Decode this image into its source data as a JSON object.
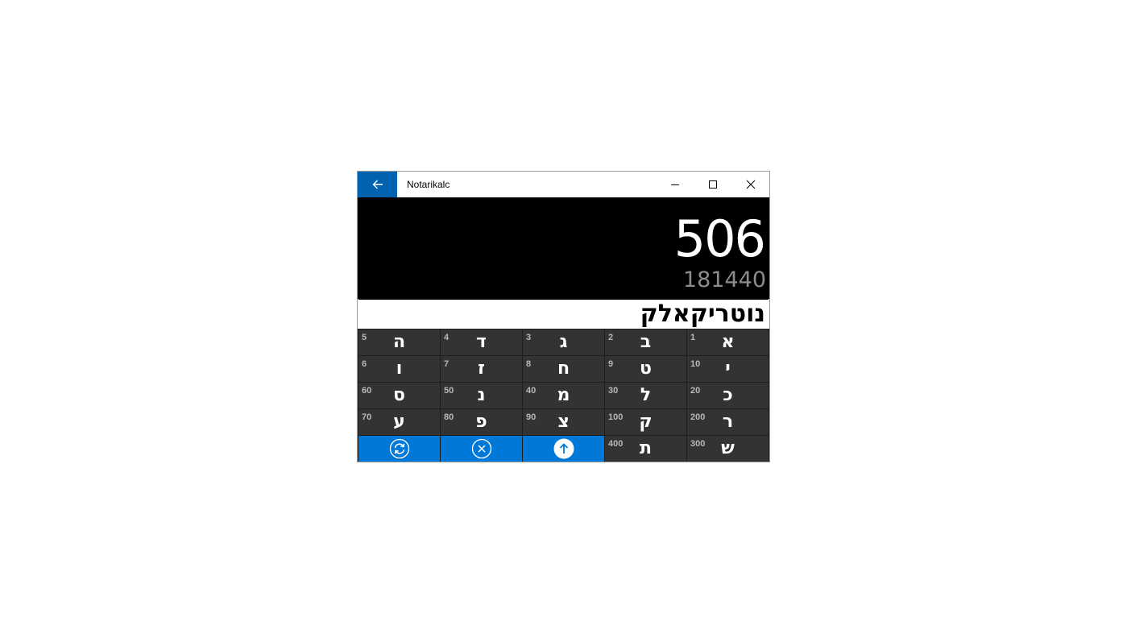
{
  "window": {
    "title": "Notarikalc",
    "accent": "#0063b1"
  },
  "display": {
    "result": "506",
    "secondary": "181440"
  },
  "input": {
    "value": "נוטריקאלק"
  },
  "keypad": {
    "rows": [
      [
        {
          "letter": "ה",
          "value": "5"
        },
        {
          "letter": "ד",
          "value": "4"
        },
        {
          "letter": "ג",
          "value": "3"
        },
        {
          "letter": "ב",
          "value": "2"
        },
        {
          "letter": "א",
          "value": "1"
        }
      ],
      [
        {
          "letter": "ו",
          "value": "6"
        },
        {
          "letter": "ז",
          "value": "7"
        },
        {
          "letter": "ח",
          "value": "8"
        },
        {
          "letter": "ט",
          "value": "9"
        },
        {
          "letter": "י",
          "value": "10"
        }
      ],
      [
        {
          "letter": "ס",
          "value": "60"
        },
        {
          "letter": "נ",
          "value": "50"
        },
        {
          "letter": "מ",
          "value": "40"
        },
        {
          "letter": "ל",
          "value": "30"
        },
        {
          "letter": "כ",
          "value": "20"
        }
      ],
      [
        {
          "letter": "ע",
          "value": "70"
        },
        {
          "letter": "פ",
          "value": "80"
        },
        {
          "letter": "צ",
          "value": "90"
        },
        {
          "letter": "ק",
          "value": "100"
        },
        {
          "letter": "ר",
          "value": "200"
        }
      ]
    ],
    "last_row_letters": [
      {
        "letter": "ת",
        "value": "400"
      },
      {
        "letter": "ש",
        "value": "300"
      }
    ],
    "actions": [
      {
        "icon": "refresh-icon"
      },
      {
        "icon": "clear-icon"
      },
      {
        "icon": "submit-arrow-up-icon"
      }
    ],
    "action_color": "#0078d7"
  }
}
